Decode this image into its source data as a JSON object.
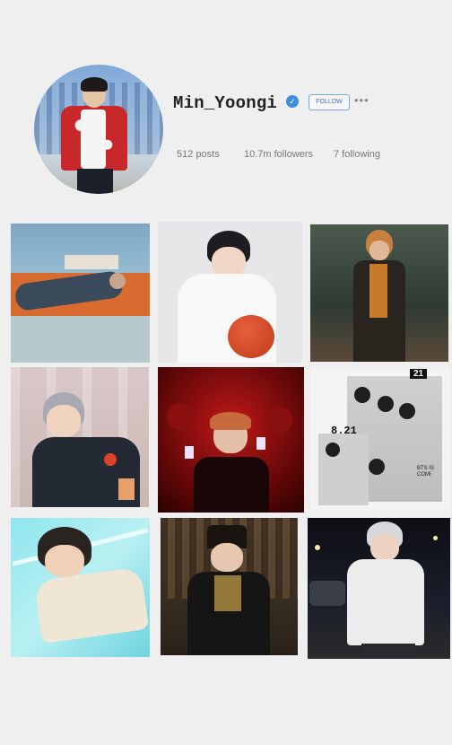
{
  "profile": {
    "username": "Min_Yoongi",
    "verified": true,
    "follow_label": "FOLLOW",
    "more_label": "•••",
    "stats": {
      "posts": "512 posts",
      "followers": "10.7m followers",
      "following": "7 following"
    },
    "accent": "#3b8fe0"
  },
  "grid": {
    "posts": [
      {
        "desc": "lying on orange sofa"
      },
      {
        "desc": "white sweater with basketball"
      },
      {
        "desc": "patterned jacket in forest"
      },
      {
        "desc": "silver hair with red stick"
      },
      {
        "desc": "red concert crowd"
      },
      {
        "desc": "group poster",
        "text1": "8.21",
        "text2": "21",
        "text3": "BTS IS COMI"
      },
      {
        "desc": "cyan lit pose"
      },
      {
        "desc": "traditional robe on throne"
      },
      {
        "desc": "white jacket at night"
      }
    ]
  }
}
